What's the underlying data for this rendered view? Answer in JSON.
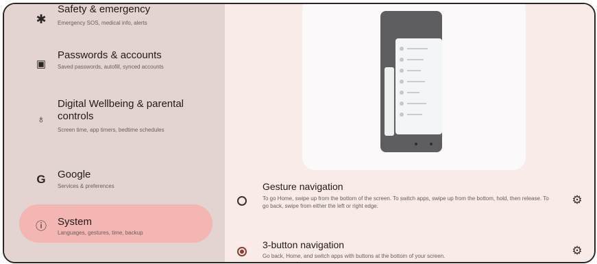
{
  "sidebar": {
    "items": [
      {
        "icon": "asterisk-icon",
        "glyph": "✱",
        "title": "Safety & emergency",
        "subtitle": "Emergency SOS, medical info, alerts"
      },
      {
        "icon": "account-box-icon",
        "glyph": "▣",
        "title": "Passwords & accounts",
        "subtitle": "Saved passwords, autofill, synced accounts"
      },
      {
        "icon": "wellbeing-icon",
        "glyph": "♁",
        "title": "Digital Wellbeing & parental controls",
        "subtitle": "Screen time, app timers, bedtime schedules"
      },
      {
        "icon": "google-icon",
        "glyph": "G",
        "title": "Google",
        "subtitle": "Services & preferences"
      },
      {
        "icon": "info-icon",
        "glyph": "ⓘ",
        "title": "System",
        "subtitle": "Languages, gestures, time, backup"
      }
    ]
  },
  "navigation": {
    "options": [
      {
        "title": "Gesture navigation",
        "description": "To go Home, swipe up from the bottom of the screen. To switch apps, swipe up from the bottom, hold, then release. To go back, swipe from either the left or right edge.",
        "selected": false
      },
      {
        "title": "3-button navigation",
        "description": "Go back, Home, and switch apps with buttons at the bottom of your screen.",
        "selected": true
      }
    ],
    "gear_glyph": "⚙"
  },
  "colors": {
    "selected_item": "#f3b6b2",
    "accent": "#8d3c38"
  }
}
